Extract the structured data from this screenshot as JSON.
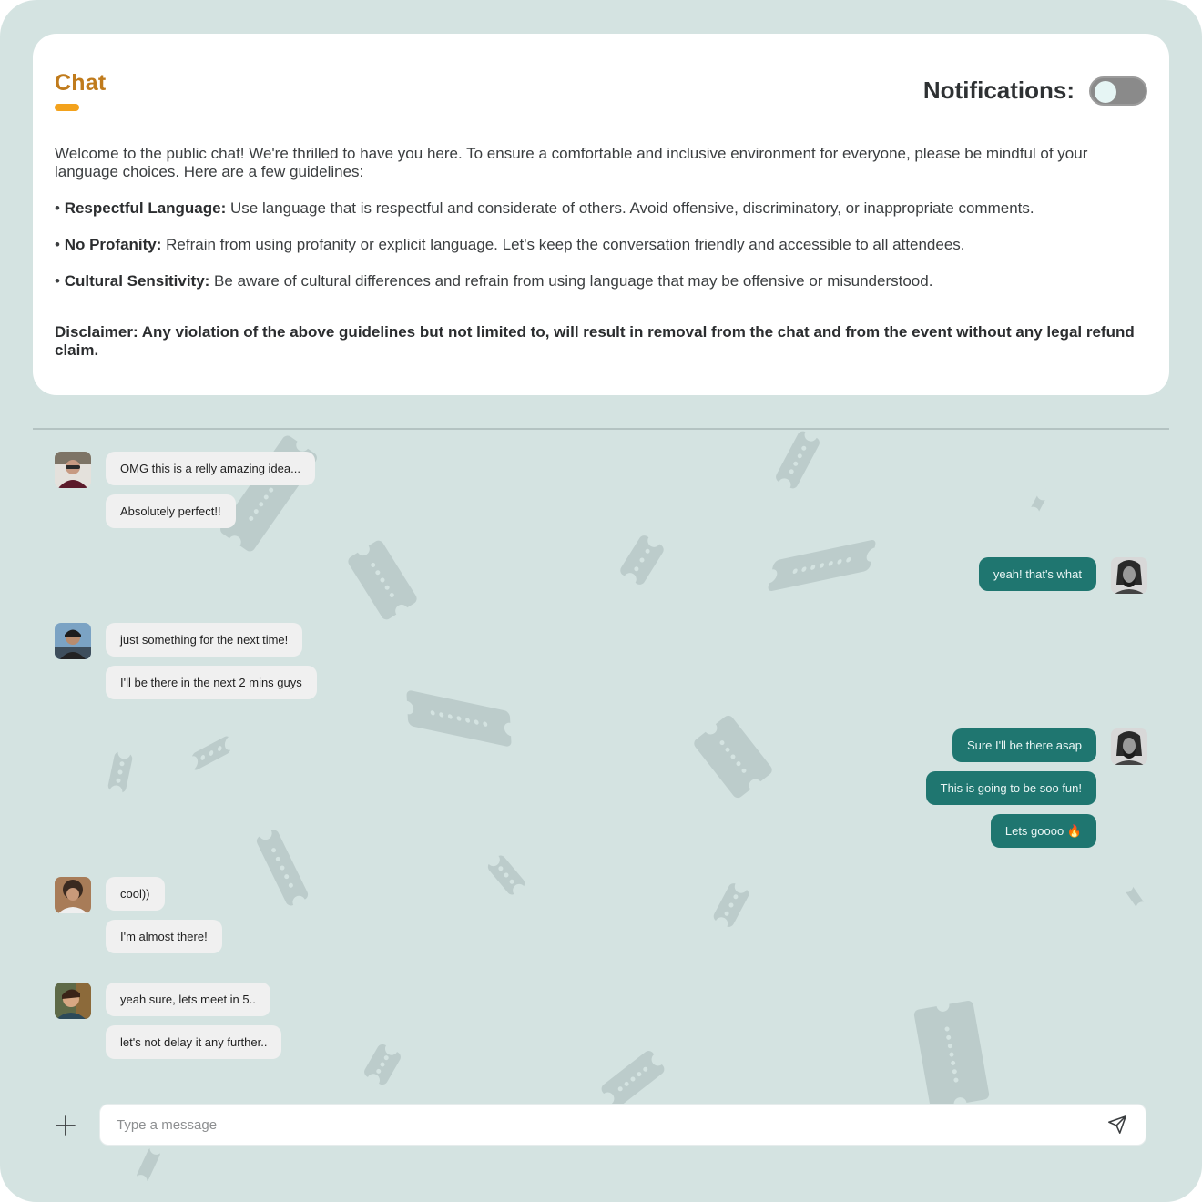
{
  "header": {
    "title": "Chat",
    "notifications_label": "Notifications:",
    "notifications_enabled": false
  },
  "guidelines": {
    "intro": "Welcome to the public chat! We're thrilled to have you here. To ensure a comfortable and inclusive environment for everyone, please be mindful of your language choices. Here are a few guidelines:",
    "rules": [
      {
        "bullet": "• ",
        "title": "Respectful Language:",
        "text": " Use language that is respectful and considerate of others. Avoid offensive, discriminatory, or inappropriate comments."
      },
      {
        "bullet": "• ",
        "title": "No Profanity:",
        "text": " Refrain from using profanity or explicit language. Let's keep the conversation friendly and accessible to all attendees."
      },
      {
        "bullet": "• ",
        "title": "Cultural Sensitivity:",
        "text": " Be aware of cultural differences and refrain from using language that may be offensive or misunderstood."
      }
    ],
    "disclaimer": "Disclaimer: Any violation of the above guidelines but not limited to, will result in removal from the chat and from the event without any legal refund claim."
  },
  "messages": {
    "group1": [
      "OMG this is a relly amazing idea...",
      "Absolutely perfect!!"
    ],
    "group2": [
      "yeah! that's what"
    ],
    "group3": [
      "just something for the next time!",
      "I'll be there in the next 2 mins guys"
    ],
    "group4": [
      "Sure I'll be there asap",
      "This is going to be soo fun!",
      "Lets goooo 🔥"
    ],
    "group5": [
      "cool))",
      "I'm almost there!"
    ],
    "group6": [
      "yeah sure, lets meet in 5..",
      "let's not delay it any further.."
    ]
  },
  "composer": {
    "placeholder": "Type a message"
  },
  "icons": {
    "add": "plus-icon",
    "send": "send-icon"
  },
  "colors": {
    "background": "#d4e3e1",
    "accent": "#c07b1c",
    "accent_bar": "#f3a21c",
    "outgoing_bubble": "#1f7670",
    "incoming_bubble": "#f0f0f0"
  }
}
